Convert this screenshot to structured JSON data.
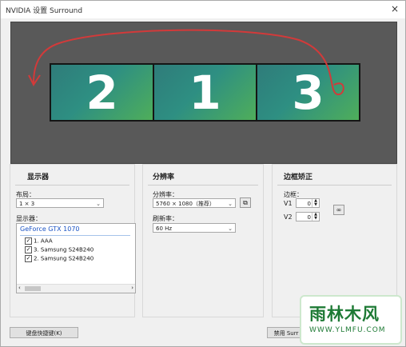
{
  "window": {
    "title": "NVIDIA 设置 Surround",
    "close": "×"
  },
  "preview": {
    "monitors": [
      "2",
      "1",
      "3"
    ]
  },
  "display_panel": {
    "title": "显示器",
    "layout_label": "布局：",
    "layout_value": "1 × 3",
    "displays_label": "显示器：",
    "gpu": "GeForce GTX 1070",
    "items": [
      "1. AAA",
      "3. Samsung S24B240",
      "2. Samsung S24B240"
    ]
  },
  "resolution_panel": {
    "title": "分辨率",
    "resolution_label": "分辨率：",
    "resolution_value": "5760 × 1080（推荐）",
    "refresh_label": "刷新率：",
    "refresh_value": "60 Hz"
  },
  "bezel_panel": {
    "title": "边框矫正",
    "bezel_label": "边框：",
    "v1_label": "V1",
    "v1_value": "0",
    "v2_label": "V2",
    "v2_value": "0"
  },
  "buttons": {
    "keyboard_shortcuts": "键盘快捷键(K)",
    "disable_surround": "禁用 Surr"
  },
  "watermark": {
    "text": "雨林木风",
    "url": "WWW.YLMFU.COM"
  }
}
